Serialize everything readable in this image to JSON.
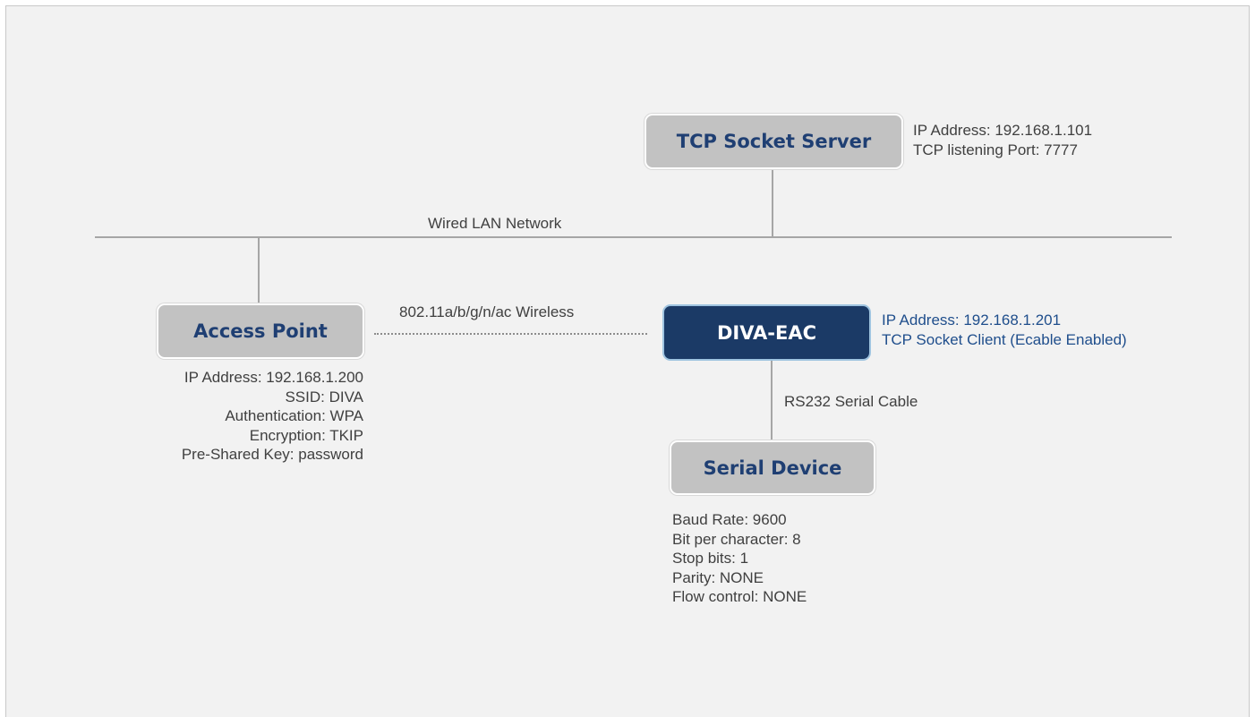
{
  "nodes": {
    "tcp_server": "TCP Socket Server",
    "access_point": "Access Point",
    "diva_eac": "DIVA-EAC",
    "serial_device": "Serial Device"
  },
  "links": {
    "wired_lan": "Wired LAN Network",
    "wireless": "802.11a/b/g/n/ac Wireless",
    "serial_cable": "RS232 Serial Cable"
  },
  "tcp_server_info": [
    "IP Address: 192.168.1.101",
    "TCP listening Port: 7777"
  ],
  "diva_info": [
    "IP Address: 192.168.1.201",
    "TCP Socket Client (Ecable Enabled)"
  ],
  "access_point_info": [
    "IP Address: 192.168.1.200",
    "SSID: DIVA",
    "Authentication: WPA",
    "Encryption: TKIP",
    "Pre-Shared Key: password"
  ],
  "serial_device_info": [
    "Baud Rate: 9600",
    "Bit per character: 8",
    "Stop bits: 1",
    "Parity: NONE",
    "Flow control: NONE"
  ],
  "colors": {
    "node_fill": "#c2c2c2",
    "node_text": "#1f3f73",
    "diva_fill": "#1b3a66",
    "diva_border": "#9fc4e0",
    "info_blue": "#1f4e8c",
    "line": "#a6a6a6"
  }
}
